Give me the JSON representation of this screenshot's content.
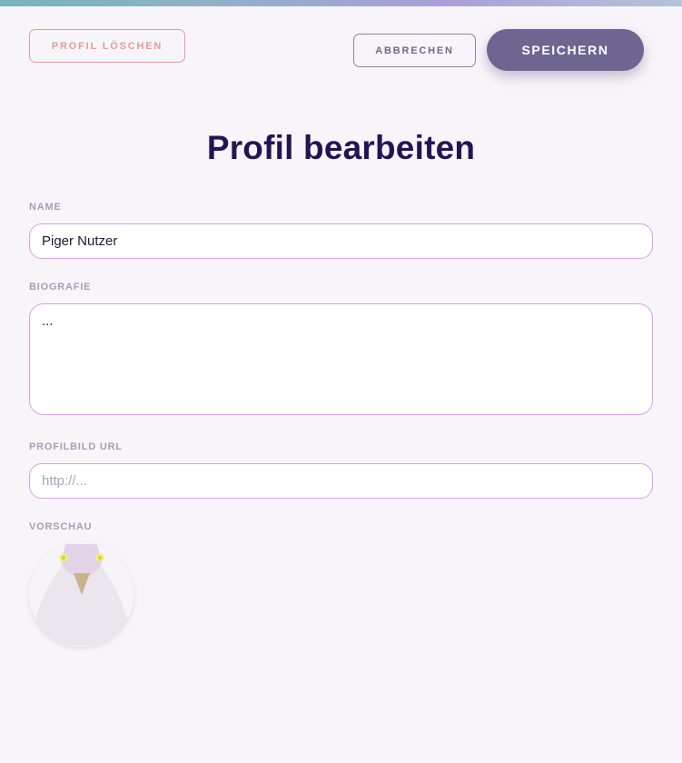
{
  "toolbar": {
    "delete_label": "PROFIL LÖSCHEN",
    "cancel_label": "ABBRECHEN",
    "save_label": "SPEICHERN"
  },
  "page": {
    "title": "Profil bearbeiten"
  },
  "form": {
    "name": {
      "label": "NAME",
      "value": "Piger Nutzer"
    },
    "bio": {
      "label": "BIOGRAFIE",
      "value": "..."
    },
    "avatar_url": {
      "label": "PROFILBILD URL",
      "placeholder": "http://...",
      "value": ""
    },
    "preview": {
      "label": "VORSCHAU",
      "icon": "pigeon-avatar-icon"
    }
  },
  "colors": {
    "accent": "#6e6691",
    "danger": "#e39a9a",
    "title": "#241552",
    "input_border": "#d6a3e4",
    "background": "#f8f5fa"
  }
}
